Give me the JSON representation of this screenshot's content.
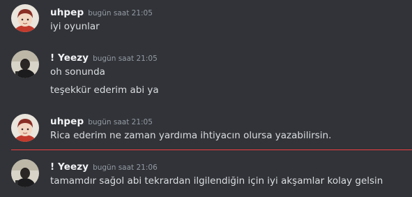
{
  "messages": [
    {
      "username": "uhpep",
      "timestamp": "bugün saat 21:05",
      "avatar": "anime-character-avatar",
      "lines": [
        "iyi oyunlar"
      ]
    },
    {
      "username": "! Yeezy",
      "timestamp": "bugün saat 21:05",
      "avatar": "dark-photo-avatar",
      "lines": [
        "oh sonunda",
        "teşekkür ederim abi ya"
      ]
    },
    {
      "username": "uhpep",
      "timestamp": "bugün saat 21:05",
      "avatar": "anime-character-avatar",
      "lines": [
        "Rica ederim ne zaman yardıma ihtiyacın olursa yazabilirsin."
      ]
    },
    {
      "username": "! Yeezy",
      "timestamp": "bugün saat 21:06",
      "avatar": "dark-photo-avatar",
      "lines": [
        "tamamdır sağol abi tekrardan ilgilendiğin için iyi akşamlar kolay gelsin"
      ]
    }
  ],
  "colors": {
    "background": "#313338",
    "username": "#f2f3f5",
    "timestamp": "#949ba4",
    "message_text": "#dbdee1",
    "new_messages_divider": "#f23f42"
  }
}
